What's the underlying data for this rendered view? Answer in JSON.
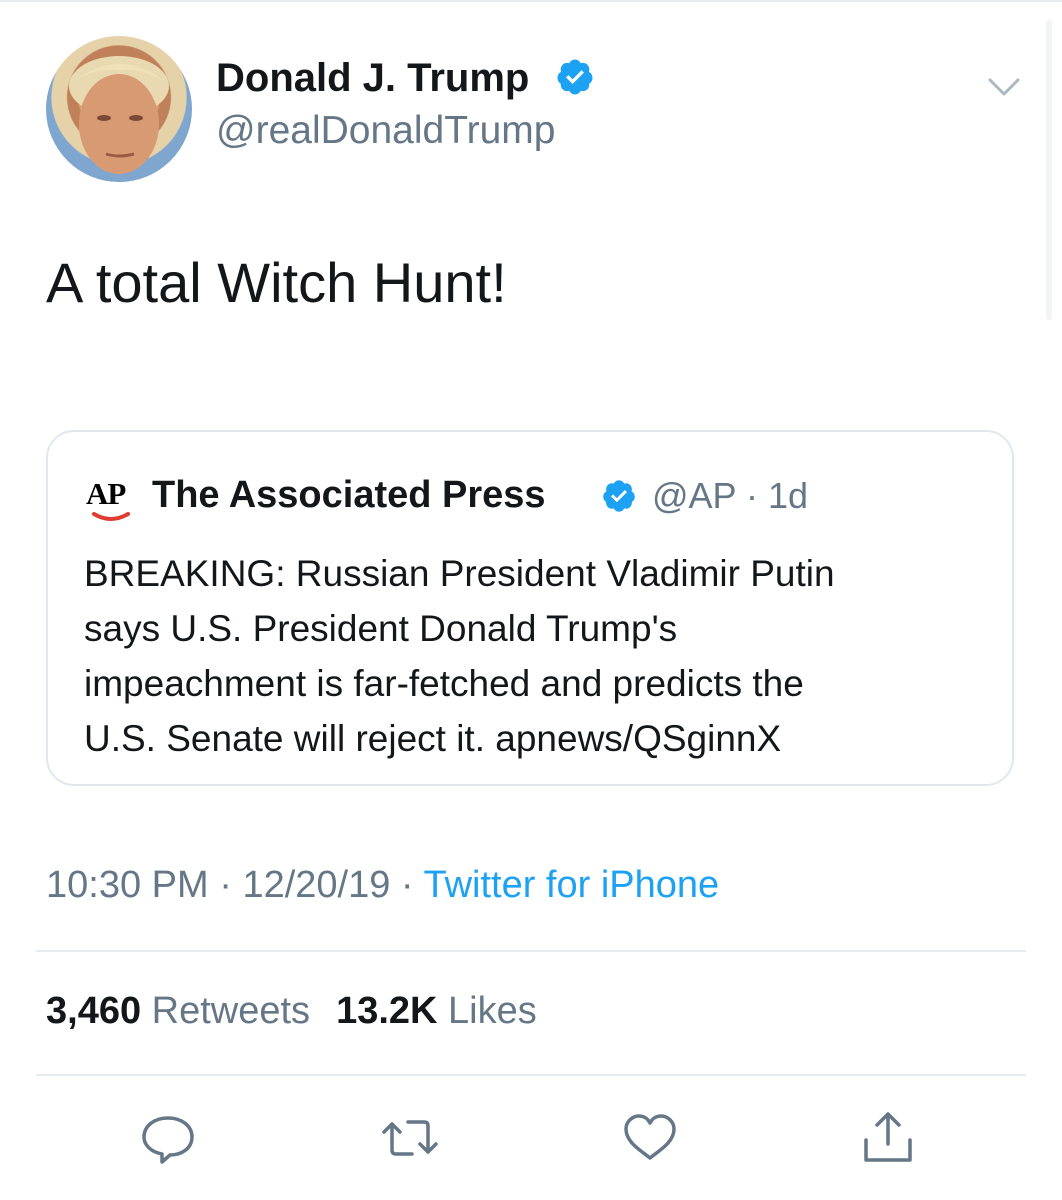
{
  "author": {
    "display_name": "Donald J. Trump",
    "handle": "@realDonaldTrump",
    "verified": true
  },
  "tweet": {
    "text": "A total Witch Hunt!",
    "time": "10:30 PM",
    "date": "12/20/19",
    "separator": "·",
    "source": "Twitter for iPhone"
  },
  "quoted": {
    "logo_text": "AP",
    "name": "The Associated Press",
    "handle": "@AP",
    "age": "1d",
    "separator": "·",
    "lines": [
      "BREAKING: Russian President Vladimir Putin",
      "says U.S. President Donald Trump's",
      "impeachment is far-fetched and predicts the",
      "U.S. Senate will reject it. apnews/QSginnX"
    ]
  },
  "stats": {
    "retweets_count": "3,460",
    "retweets_label": "Retweets",
    "likes_count": "13.2K",
    "likes_label": "Likes"
  },
  "actions": [
    "reply-icon",
    "retweet-icon",
    "like-icon",
    "share-icon"
  ],
  "colors": {
    "text": "#14171a",
    "secondary": "#657786",
    "link": "#1da1f2",
    "verified": "#1da1f2",
    "border": "#e1e8ed",
    "ap_swoosh": "#e03c31"
  }
}
